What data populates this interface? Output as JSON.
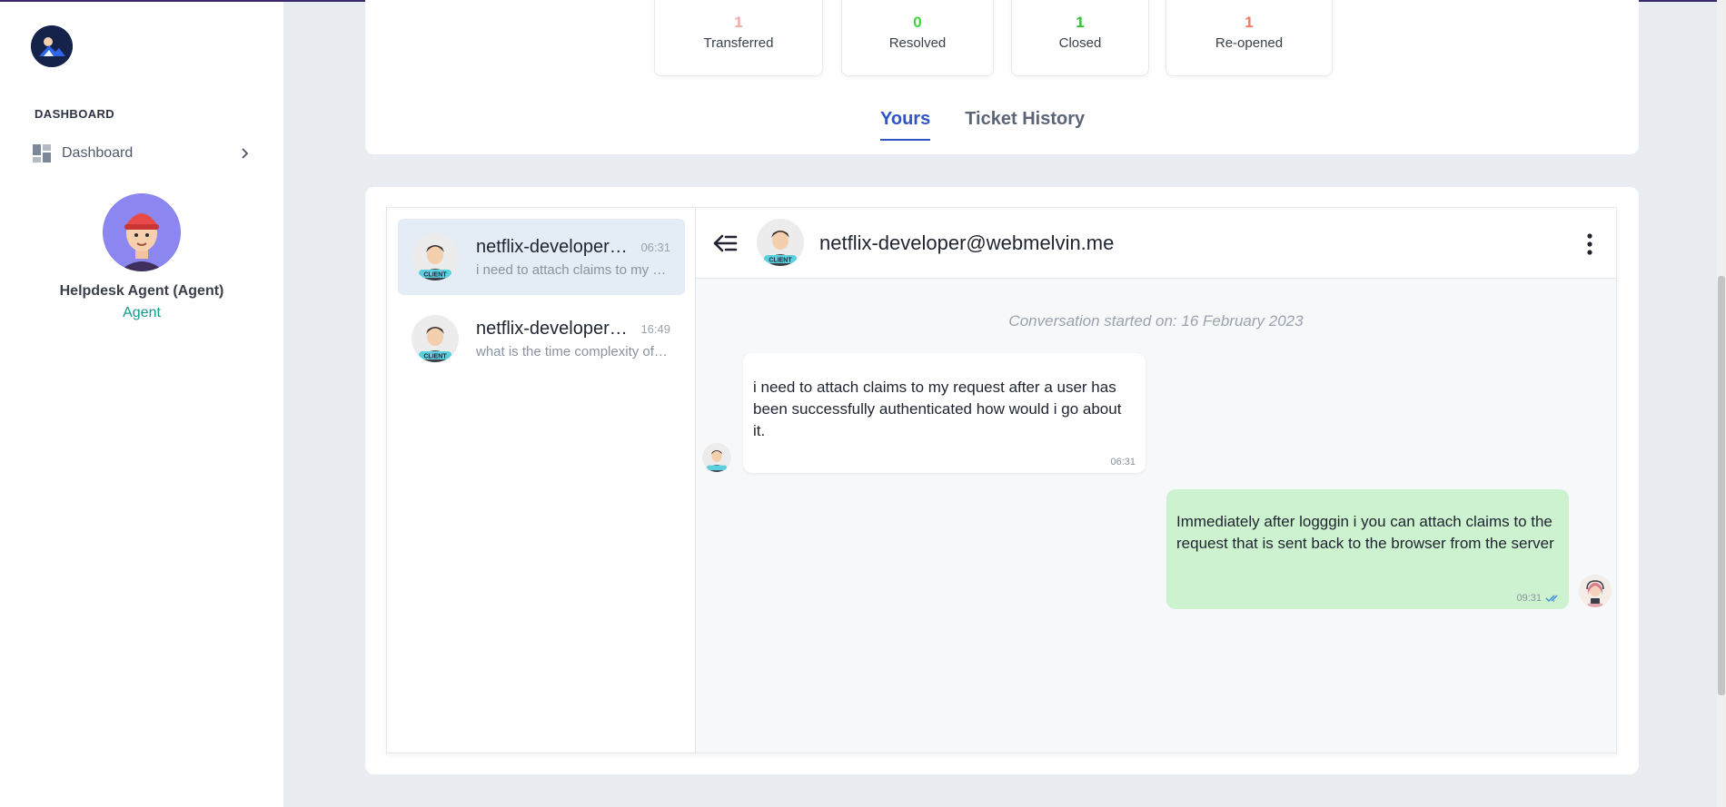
{
  "sidebar": {
    "section_title": "DASHBOARD",
    "nav_items": [
      {
        "label": "Dashboard",
        "icon": "dashboard-grid-icon"
      }
    ],
    "profile": {
      "name": "Helpdesk Agent (Agent)",
      "role": "Agent"
    }
  },
  "stats": [
    {
      "value": "1",
      "label": "Transferred",
      "color": "#f0a8a8"
    },
    {
      "value": "0",
      "label": "Resolved",
      "color": "#42d242"
    },
    {
      "value": "1",
      "label": "Closed",
      "color": "#2dc12d"
    },
    {
      "value": "1",
      "label": "Re-opened",
      "color": "#ee7a5c"
    }
  ],
  "tabs": [
    {
      "label": "Yours",
      "active": true
    },
    {
      "label": "Ticket History",
      "active": false
    }
  ],
  "conversations": [
    {
      "name": "netflix-developer@webmelvin.me",
      "time": "06:31",
      "preview": "i need to attach claims to my request after a user has been successfully authenticated how would i go about it.",
      "active": true
    },
    {
      "name": "netflix-developer@webmelvin.me",
      "time": "16:49",
      "preview": "what is the time complexity of the algorithm",
      "active": false
    }
  ],
  "chat": {
    "contact": "netflix-developer@webmelvin.me",
    "started_label": "Conversation started on: 16 February 2023",
    "messages": [
      {
        "direction": "in",
        "text": "i need to attach claims to my request after a user has been successfully authenticated how would i go about it.",
        "time": "06:31"
      },
      {
        "direction": "out",
        "text": "Immediately after logggin i you can attach claims to the request that is sent back to the browser from the server",
        "time": "09:31",
        "status": "read"
      }
    ]
  },
  "colors": {
    "accent": "#2d55c8",
    "agent_role": "#11998e",
    "outgoing_bubble": "#cdf2cf",
    "active_conversation": "#e4ecf6"
  }
}
